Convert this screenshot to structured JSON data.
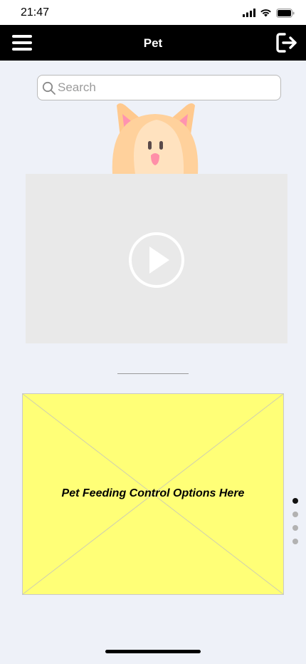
{
  "status": {
    "time": "21:47",
    "icons": [
      "signal-icon",
      "wifi-icon",
      "battery-icon"
    ]
  },
  "header": {
    "title": "Pet",
    "menu_icon": "hamburger-menu-icon",
    "logout_icon": "logout-icon"
  },
  "search": {
    "placeholder": "Search",
    "value": ""
  },
  "video": {
    "play_icon": "play-icon"
  },
  "panel": {
    "label": "Pet Feeding Control Options Here"
  },
  "pagination": {
    "total": 4,
    "active": 1
  },
  "colors": {
    "background": "#eef1f8",
    "header": "#000000",
    "video_bg": "#e9e9e9",
    "panel_bg": "#ffff77",
    "active_dot": "#111111",
    "inactive_dot": "#b2b2b2"
  }
}
